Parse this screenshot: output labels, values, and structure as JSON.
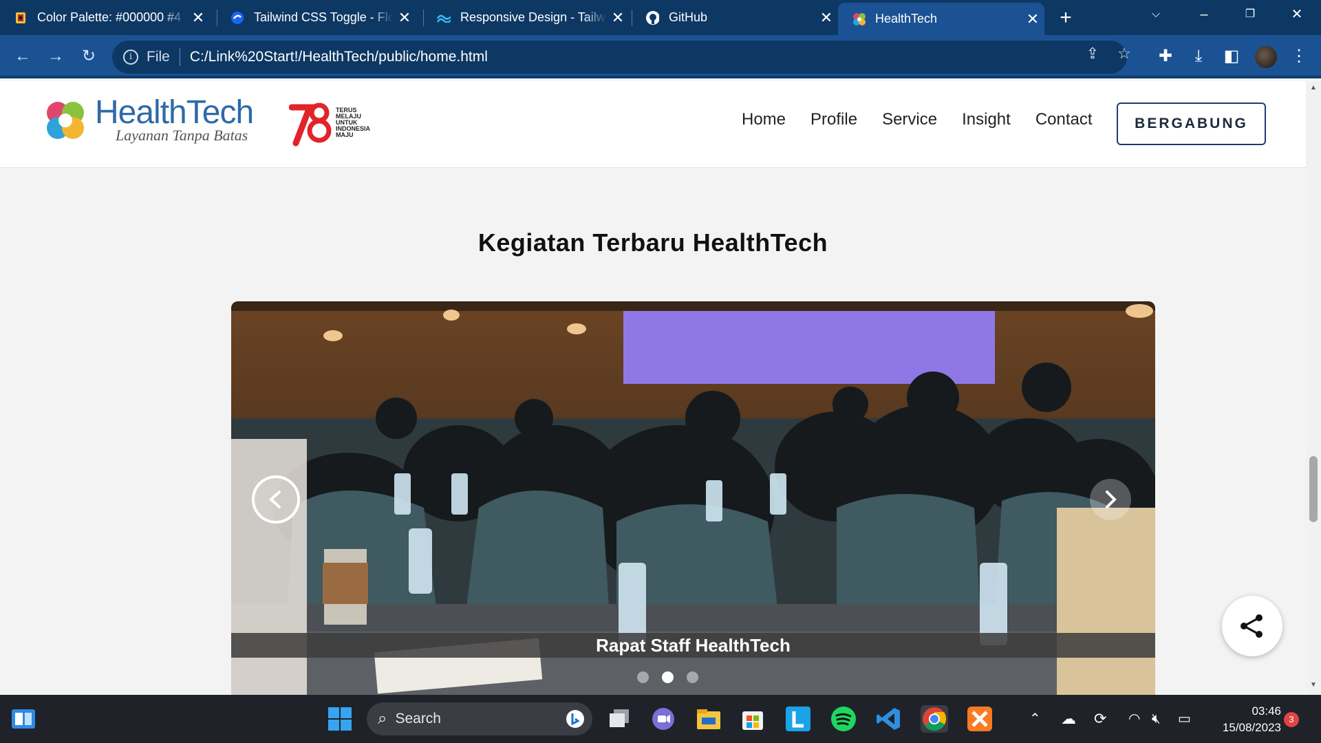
{
  "browser": {
    "tabs": [
      {
        "title": "Color Palette: #000000 #4",
        "icon": "color-palette-favicon"
      },
      {
        "title": "Tailwind CSS Toggle - Flow",
        "icon": "flowbite-favicon"
      },
      {
        "title": "Responsive Design - Tailw",
        "icon": "tailwind-favicon"
      },
      {
        "title": "GitHub",
        "icon": "github-favicon"
      },
      {
        "title": "HealthTech",
        "icon": "healthtech-favicon",
        "active": true
      }
    ],
    "address_scheme": "File",
    "address_url": "C:/Link%20Start!/HealthTech/public/home.html"
  },
  "site": {
    "brand_name": "HealthTech",
    "tagline": "Layanan Tanpa Batas",
    "anniversary_text": [
      "TERUS",
      "MELAJU",
      "UNTUK",
      "INDONESIA",
      "MAJU"
    ],
    "nav": [
      "Home",
      "Profile",
      "Service",
      "Insight",
      "Contact"
    ],
    "cta": "BERGABUNG",
    "section_title": "Kegiatan Terbaru HealthTech",
    "carousel": {
      "caption": "Rapat Staff HealthTech",
      "slide_count": 3,
      "active_slide": 2
    }
  },
  "taskbar": {
    "search_placeholder": "Search",
    "time": "03:46",
    "date": "15/08/2023",
    "notification_count": "3"
  },
  "colors": {
    "tab_bar": "#0e3864",
    "toolbar": "#1a5293",
    "brand_blue": "#2e6aa8",
    "cta_border": "#1c3b70"
  }
}
